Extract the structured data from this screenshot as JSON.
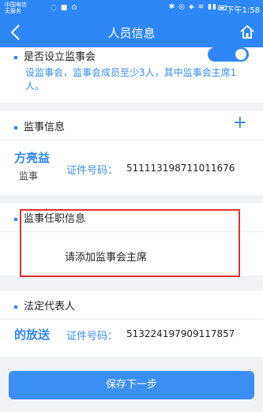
{
  "status_bar": {
    "carrier_line1": "中国电信",
    "carrier_line2": "无服务",
    "time": "下午1:58"
  },
  "nav": {
    "title": "人员信息",
    "back_icon": "back-chevron-icon",
    "home_icon": "home-icon"
  },
  "supervisory_board": {
    "question": "是否设立监事会",
    "toggle_on": true,
    "description": "设监事会，监事会成员至少3人，其中监事会主席1人。"
  },
  "supervisor_info": {
    "title": "监事信息",
    "add_icon": "plus-icon",
    "person": {
      "name": "方亮益",
      "role": "监事",
      "id_label": "证件号码：",
      "id_number": "511113198711011676"
    }
  },
  "supervisor_position": {
    "title": "监事任职信息",
    "add_chairman": "请添加监事会主席"
  },
  "legal_rep": {
    "title": "法定代表人",
    "person": {
      "name": "的放送",
      "id_label": "证件号码：",
      "id_number": "513224197909117857"
    }
  },
  "actions": {
    "save_next": "保存下一步"
  },
  "colors": {
    "primary": "#2f86f6",
    "highlight_border": "#e0322d",
    "background": "#f1f2f6"
  }
}
